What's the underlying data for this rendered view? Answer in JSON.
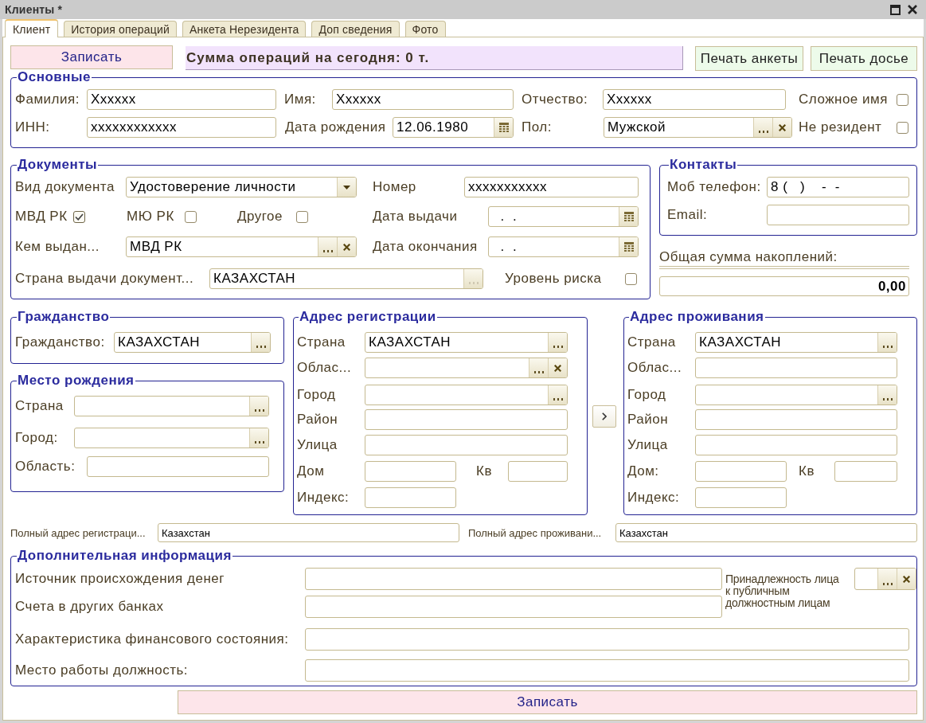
{
  "window": {
    "title": "Клиенты *"
  },
  "tabs": [
    {
      "label": "Клиент",
      "selected": true
    },
    {
      "label": "История операций",
      "selected": false
    },
    {
      "label": "Анкета Нерезидента",
      "selected": false
    },
    {
      "label": "Доп сведения",
      "selected": false
    },
    {
      "label": "Фото",
      "selected": false
    }
  ],
  "toolbar": {
    "save_button": "Записать",
    "summary": "Сумма операций на сегодня: 0 т.",
    "print_buttons": [
      "Печать анкеты",
      "Печать досье"
    ]
  },
  "basic": {
    "title": "Основные",
    "rows": [
      [
        {
          "kind": "text",
          "label": "Фамилия:",
          "value": "Xxxxxx"
        },
        {
          "kind": "text",
          "label": "Имя:",
          "value": "Xxxxxx"
        },
        {
          "kind": "text",
          "label": "Отчество:",
          "value": "Xxxxxx"
        },
        {
          "kind": "checkbox",
          "label": "Сложное имя",
          "checked": false
        }
      ],
      [
        {
          "kind": "text",
          "label": "ИНН:",
          "value": "xxxxxxxxxxxx"
        },
        {
          "kind": "date",
          "label": "Дата рождения",
          "value": "12.06.1980"
        },
        {
          "kind": "picker",
          "label": "Пол:",
          "value": "Мужской",
          "clearable": true,
          "button_disabled": false
        },
        {
          "kind": "checkbox",
          "label": "Не резидент",
          "checked": false
        }
      ]
    ]
  },
  "documents": {
    "title": "Документы",
    "rows": [
      [
        {
          "kind": "dropdown",
          "label": "Вид документа",
          "value": "Удостоверение личности"
        },
        {
          "kind": "text",
          "label": "Номер",
          "value": "xxxxxxxxxxx"
        }
      ],
      [
        {
          "kind": "checkgroup",
          "items": [
            {
              "label": "МВД РК",
              "checked": true
            },
            {
              "label": "МЮ РК",
              "checked": false
            },
            {
              "label": "Другое",
              "checked": false
            }
          ]
        },
        {
          "kind": "date",
          "label": "Дата выдачи",
          "value": "  .  ."
        }
      ],
      [
        {
          "kind": "picker",
          "label": "Кем выдан...",
          "value": "МВД РК",
          "clearable": true,
          "button_disabled": false
        },
        {
          "kind": "date",
          "label": "Дата окончания",
          "value": "  .  ."
        }
      ],
      [
        {
          "kind": "picker",
          "label": "Страна выдачи документ...",
          "value": "КАЗАХСТАН",
          "clearable": false,
          "button_disabled": true
        },
        {
          "kind": "checkbox",
          "label": "Уровень риска",
          "checked": false
        }
      ]
    ]
  },
  "contacts": {
    "title": "Контакты",
    "rows": [
      [
        {
          "kind": "text",
          "label": "Моб телефон:",
          "value": "8 (   )    -  -"
        }
      ],
      [
        {
          "kind": "text",
          "label": "Email:"
        }
      ]
    ]
  },
  "savings": {
    "label": "Общая сумма накоплений:",
    "value": "0,00"
  },
  "citizenship": {
    "title": "Гражданство",
    "rows": [
      [
        {
          "kind": "picker",
          "label": "Гражданство:",
          "value": "КАЗАХСТАН",
          "clearable": false,
          "button_disabled": false
        }
      ]
    ]
  },
  "birthplace": {
    "title": "Место рождения",
    "rows": [
      [
        {
          "kind": "picker",
          "label": "Страна",
          "clearable": false,
          "button_disabled": false
        }
      ],
      [
        {
          "kind": "picker",
          "label": "Город:",
          "clearable": false,
          "button_disabled": false
        }
      ],
      [
        {
          "kind": "text",
          "label": "Область:"
        }
      ]
    ]
  },
  "registration_address": {
    "title": "Адрес регистрации",
    "rows": [
      [
        {
          "kind": "picker",
          "label": "Страна",
          "value": "КАЗАХСТАН",
          "clearable": false,
          "button_disabled": false
        }
      ],
      [
        {
          "kind": "picker",
          "label": "Облас...",
          "clearable": true,
          "button_disabled": false
        }
      ],
      [
        {
          "kind": "picker",
          "label": "Город",
          "clearable": false,
          "button_disabled": false
        }
      ],
      [
        {
          "kind": "text",
          "label": "Район"
        }
      ],
      [
        {
          "kind": "text",
          "label": "Улица"
        }
      ],
      [
        {
          "kind": "text",
          "label": "Дом"
        },
        {
          "kind": "text",
          "label": "Кв"
        }
      ],
      [
        {
          "kind": "text",
          "label": "Индекс:"
        }
      ]
    ]
  },
  "residence_address": {
    "title": "Адрес проживания",
    "rows": [
      [
        {
          "kind": "picker",
          "label": "Страна",
          "value": "КАЗАХСТАН",
          "clearable": false,
          "button_disabled": false
        }
      ],
      [
        {
          "kind": "text",
          "label": "Облас..."
        }
      ],
      [
        {
          "kind": "picker",
          "label": "Город",
          "clearable": false,
          "button_disabled": false
        }
      ],
      [
        {
          "kind": "text",
          "label": "Район"
        }
      ],
      [
        {
          "kind": "text",
          "label": "Улица"
        }
      ],
      [
        {
          "kind": "text",
          "label": "Дом:"
        },
        {
          "kind": "text",
          "label": "Кв"
        }
      ],
      [
        {
          "kind": "text",
          "label": "Индекс:"
        }
      ]
    ]
  },
  "full_addresses": [
    {
      "label": "Полный адрес регистраци...",
      "value": "Казахстан"
    },
    {
      "label": "Полный адрес проживани...",
      "value": "Казахстан"
    }
  ],
  "additional": {
    "title": "Дополнительная информация",
    "fields": [
      {
        "label": "Источник происхождения денег"
      },
      {
        "label": "Счета в других банках"
      },
      {
        "label": "Характеристика финансового состояния:"
      },
      {
        "label": "Место работы должность:"
      }
    ],
    "pep": {
      "label": "Принадлежность лица к публичным должностным лицам",
      "clearable": true
    }
  },
  "footer": {
    "save_button": "Записать"
  }
}
